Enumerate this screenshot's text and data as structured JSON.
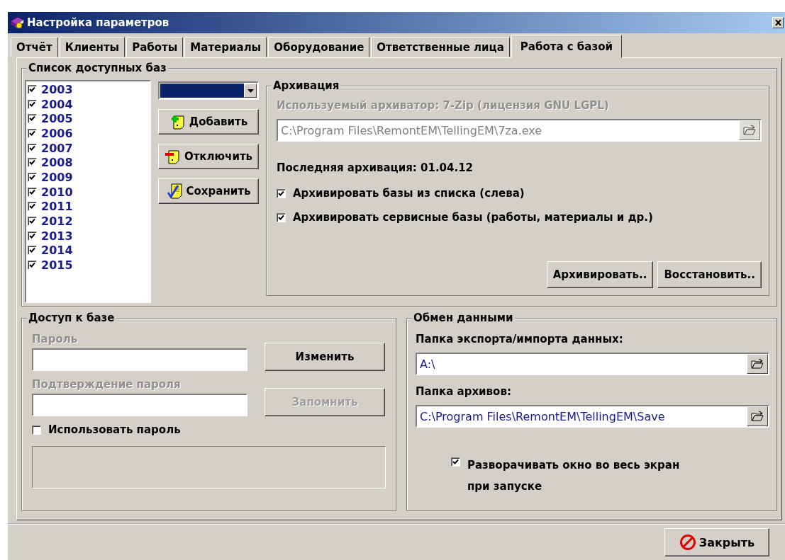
{
  "window": {
    "title": "Настройка параметров"
  },
  "tabs": [
    {
      "label": "Отчёт",
      "selected": false
    },
    {
      "label": "Клиенты",
      "selected": false
    },
    {
      "label": "Работы",
      "selected": false
    },
    {
      "label": "Материалы",
      "selected": false
    },
    {
      "label": "Оборудование",
      "selected": false
    },
    {
      "label": "Ответственные лица",
      "selected": false
    },
    {
      "label": "Работа с базой",
      "selected": true
    }
  ],
  "databases": {
    "title": "Список доступных баз",
    "items": [
      {
        "label": "2003",
        "checked": true
      },
      {
        "label": "2004",
        "checked": true
      },
      {
        "label": "2005",
        "checked": true
      },
      {
        "label": "2006",
        "checked": true
      },
      {
        "label": "2007",
        "checked": true
      },
      {
        "label": "2008",
        "checked": true
      },
      {
        "label": "2009",
        "checked": true
      },
      {
        "label": "2010",
        "checked": true
      },
      {
        "label": "2011",
        "checked": true
      },
      {
        "label": "2012",
        "checked": true
      },
      {
        "label": "2013",
        "checked": true
      },
      {
        "label": "2014",
        "checked": true
      },
      {
        "label": "2015",
        "checked": true
      }
    ],
    "buttons": [
      {
        "label": "Добавить",
        "kind": "add"
      },
      {
        "label": "Отключить",
        "kind": "remove"
      },
      {
        "label": "Сохранить",
        "kind": "save"
      }
    ]
  },
  "archive": {
    "title": "Архивация",
    "archiver_label": "Используемый архиватор: 7-Zip (лицензия GNU LGPL)",
    "archiver_path": {
      "value": "C:\\Program Files\\RemontEM\\TellingEM\\7za.exe",
      "disabled": true
    },
    "last_archive": "Последняя архивация: 01.04.12",
    "options": [
      {
        "label": "Архивировать базы из списка (слева)",
        "checked": true
      },
      {
        "label": "Архивировать сервисные базы (работы, материалы и др.)",
        "checked": true
      }
    ],
    "buttons": [
      "Архивировать..",
      "Восстановить.."
    ]
  },
  "access": {
    "title": "Доступ к базе",
    "fields": [
      {
        "label": "Пароль",
        "disabled": true,
        "button": {
          "label": "Изменить",
          "disabled": false
        }
      },
      {
        "label": "Подтверждение пароля",
        "disabled": true,
        "button": {
          "label": "Запомнить",
          "disabled": true
        }
      }
    ],
    "use_password": {
      "label": "Использовать пароль",
      "checked": false
    }
  },
  "exchange": {
    "title": "Обмен данными",
    "fields": [
      {
        "label": "Папка экспорта/импорта данных:",
        "value": "A:\\"
      },
      {
        "label": "Папка архивов:",
        "value": "C:\\Program Files\\RemontEM\\TellingEM\\Save"
      }
    ],
    "maximize": {
      "label": "Разворачивать окно во весь экран при запуске",
      "checked": true
    }
  },
  "close_button": "Закрыть"
}
